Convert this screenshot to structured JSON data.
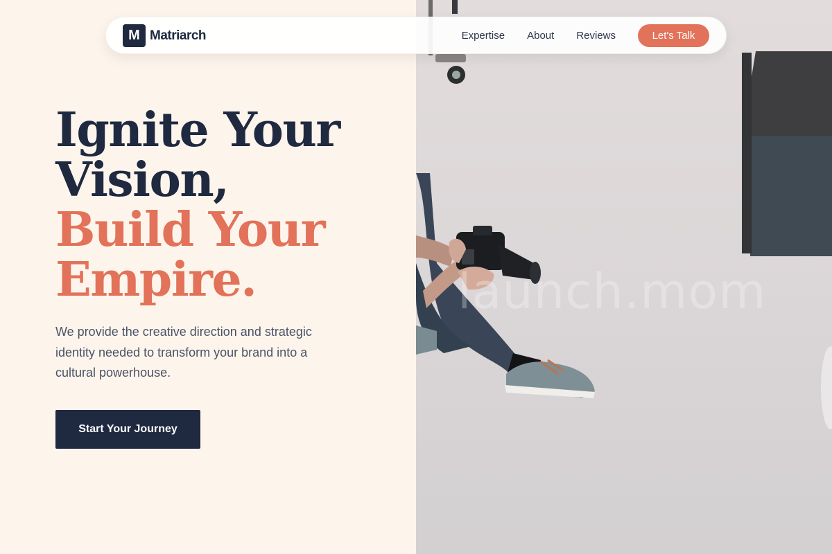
{
  "nav": {
    "logo_mark": "M",
    "brand": "Matriarch",
    "links": [
      "Expertise",
      "About",
      "Reviews"
    ],
    "cta": "Let's Talk"
  },
  "hero": {
    "headline_dark_1": "Ignite Your",
    "headline_dark_2": "Vision,",
    "headline_accent_1": "Build Your",
    "headline_accent_2": "Empire.",
    "subcopy": "We provide the creative direction and strategic identity needed to transform your brand into a cultural powerhouse.",
    "cta": "Start Your Journey"
  },
  "photo": {
    "watermark": "launch.mom"
  },
  "colors": {
    "background": "#fdf5ec",
    "navy": "#1f2940",
    "accent": "#e27259",
    "body_text": "#4a5266"
  }
}
